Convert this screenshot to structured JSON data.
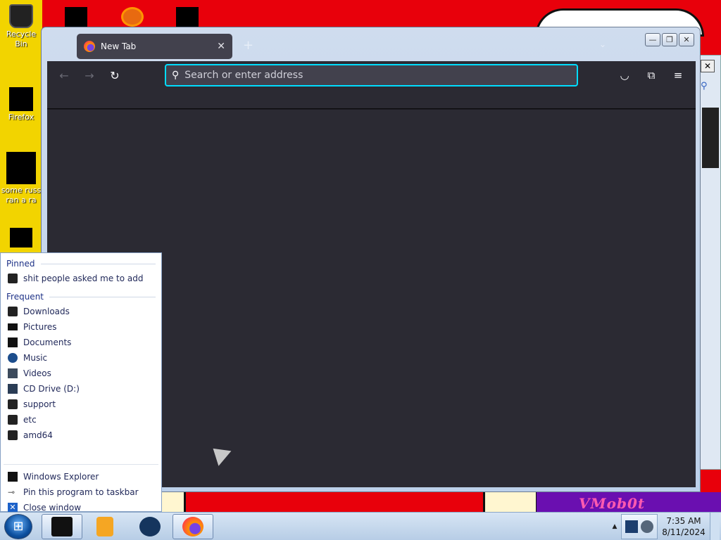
{
  "desktop": {
    "icons": [
      {
        "label": "Recycle Bin"
      },
      {
        "label": "Firefox"
      },
      {
        "label": "some russ ran a ra"
      }
    ],
    "wallpaper_text": "VMob0t"
  },
  "browser": {
    "tab_title": "New Tab",
    "new_tab_symbol": "+",
    "address_placeholder": "Search or enter address",
    "address_value": "",
    "window_controls": {
      "minimize": "—",
      "maximize": "❐",
      "close": "✕"
    }
  },
  "jumplist": {
    "pinned_header": "Pinned",
    "pinned": [
      {
        "label": "shit people asked me to add",
        "icon": "folder-icon"
      }
    ],
    "frequent_header": "Frequent",
    "frequent": [
      {
        "label": "Downloads",
        "icon": "downloads-icon"
      },
      {
        "label": "Pictures",
        "icon": "pictures-icon"
      },
      {
        "label": "Documents",
        "icon": "documents-icon"
      },
      {
        "label": "Music",
        "icon": "music-icon"
      },
      {
        "label": "Videos",
        "icon": "videos-icon"
      },
      {
        "label": "CD Drive (D:)",
        "icon": "cd-drive-icon"
      },
      {
        "label": "support",
        "icon": "folder-icon"
      },
      {
        "label": "etc",
        "icon": "folder-icon"
      },
      {
        "label": "amd64",
        "icon": "folder-icon"
      }
    ],
    "actions": [
      {
        "label": "Windows Explorer",
        "icon": "explorer-icon"
      },
      {
        "label": "Pin this program to taskbar",
        "icon": "pin-icon"
      },
      {
        "label": "Close window",
        "icon": "close-window-icon"
      }
    ]
  },
  "taskbar": {
    "time": "7:35 AM",
    "date": "8/11/2024"
  },
  "colors": {
    "accent_focus": "#00ddff",
    "browser_dark": "#2b2a33",
    "jumplist_text": "#21295a"
  }
}
